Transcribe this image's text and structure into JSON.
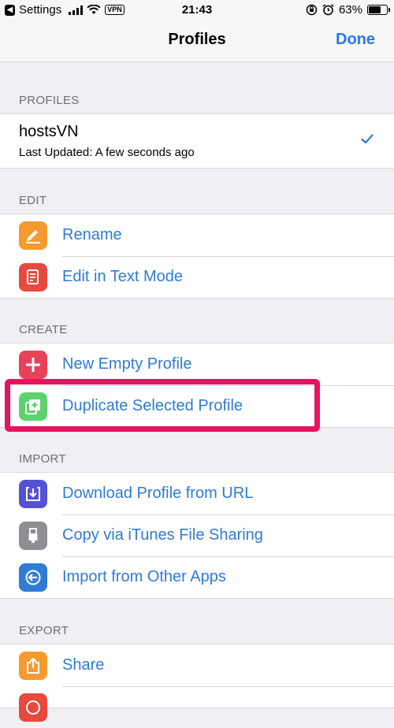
{
  "status_bar": {
    "back_app": "Settings",
    "vpn": "VPN",
    "time": "21:43",
    "battery": "63%",
    "battery_level": 0.63
  },
  "nav": {
    "title": "Profiles",
    "done": "Done"
  },
  "sections": {
    "profiles": {
      "header": "PROFILES",
      "name": "hostsVN",
      "subtitle": "Last Updated: A few seconds ago"
    },
    "edit": {
      "header": "EDIT",
      "items": [
        "Rename",
        "Edit in Text Mode"
      ]
    },
    "create": {
      "header": "CREATE",
      "items": [
        "New Empty Profile",
        "Duplicate Selected Profile"
      ]
    },
    "import": {
      "header": "IMPORT",
      "items": [
        "Download Profile from URL",
        "Copy via iTunes File Sharing",
        "Import from Other Apps"
      ]
    },
    "export": {
      "header": "EXPORT",
      "items": [
        "Share"
      ]
    }
  },
  "colors": {
    "accent": "#2f7bd5",
    "highlight": "#e8125e"
  }
}
